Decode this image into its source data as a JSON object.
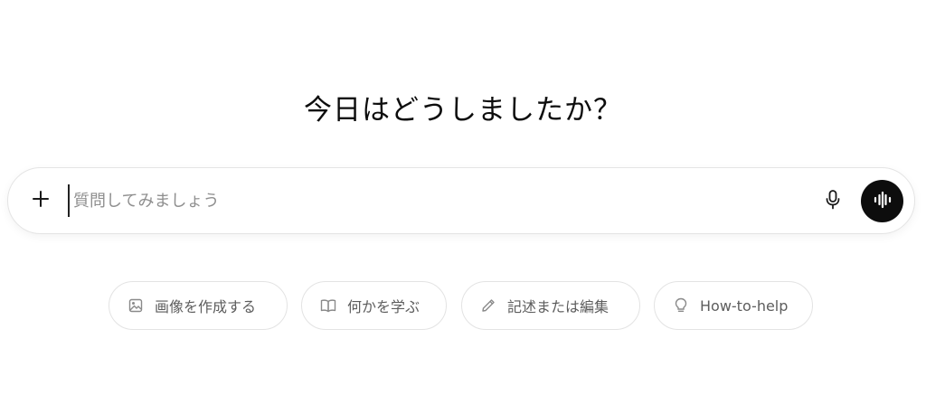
{
  "heading": "今日はどうしましたか？",
  "composer": {
    "placeholder": "質問してみましょう",
    "value": ""
  },
  "icons": {
    "attach": "plus-icon",
    "mic": "microphone-icon",
    "voice": "voice-waveform-icon"
  },
  "suggestions": [
    {
      "label": "画像を作成する",
      "icon": "image-icon"
    },
    {
      "label": "何かを学ぶ",
      "icon": "open-book-icon"
    },
    {
      "label": "記述または編集",
      "icon": "pencil-icon"
    },
    {
      "label": "How-to-help",
      "icon": "lightbulb-icon"
    }
  ],
  "colors": {
    "background": "#ffffff",
    "voice_button": "#0d0d0d",
    "placeholder": "#8f8f8f",
    "chip_text": "#5d5d5d",
    "chip_border": "#e3e3e3"
  }
}
